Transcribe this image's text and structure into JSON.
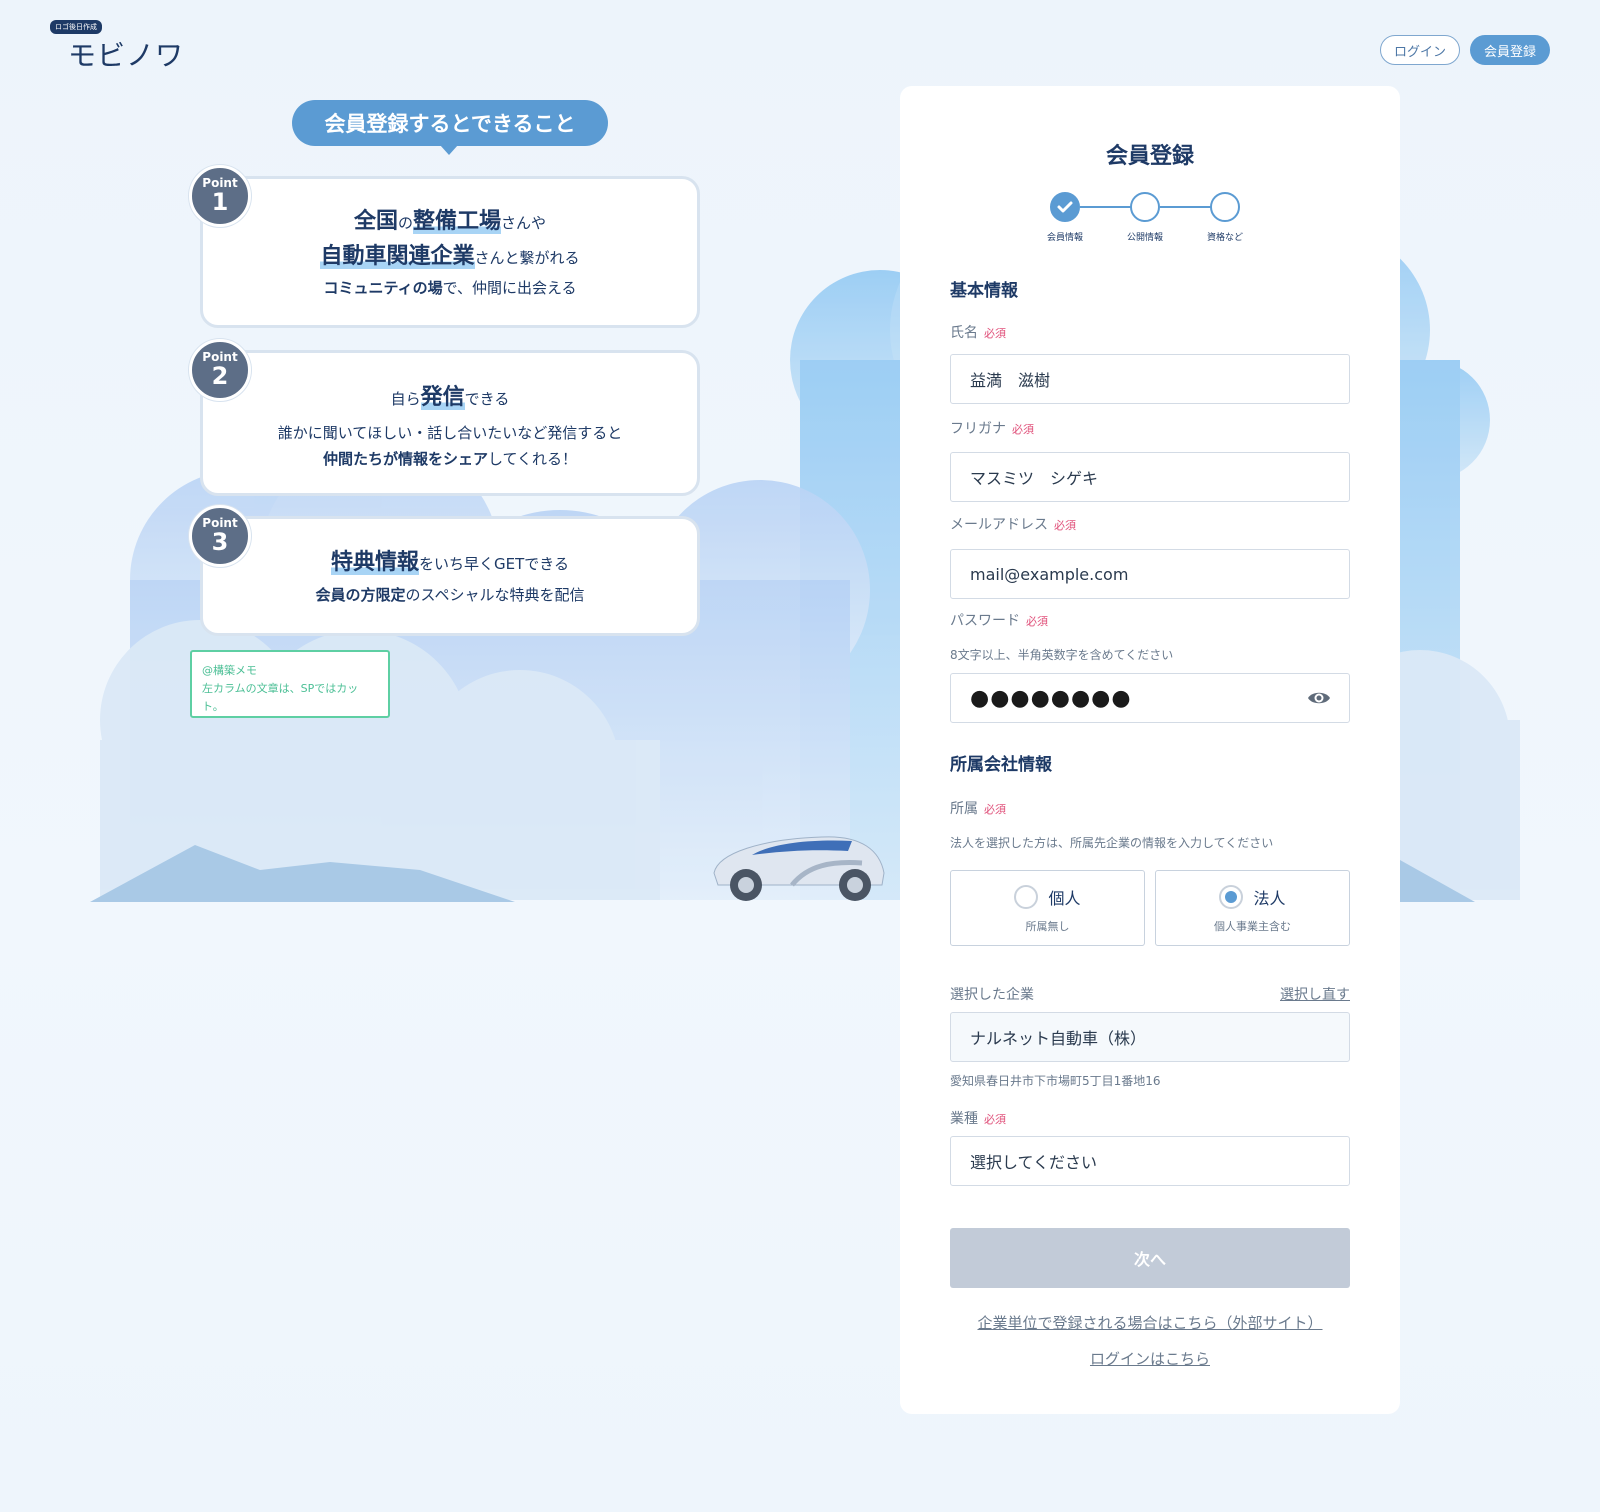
{
  "header": {
    "logo_badge": "ロゴ後日作成",
    "logo_text": "モビノワ",
    "login_label": "ログイン",
    "register_label": "会員登録"
  },
  "features": {
    "title": "会員登録するとできること",
    "point_label": "Point",
    "points": [
      {
        "number": "1",
        "line1_a": "全国",
        "line1_b": "の",
        "line1_c": "整備工場",
        "line1_d": "さんや",
        "line2_a": "自動車関連企業",
        "line2_b": "さんと繋がれる",
        "line3_a": "コミュニティの場",
        "line3_b": "で、仲間に出会える"
      },
      {
        "number": "2",
        "line1_a": "自ら",
        "line1_b": "発信",
        "line1_c": "できる",
        "line2": "誰かに聞いてほしい・話し合いたいなど発信すると",
        "line3_a": "仲間たちが情報をシェア",
        "line3_b": "してくれる！"
      },
      {
        "number": "3",
        "line1_a": "特典情報",
        "line1_b": "をいち早くGETできる",
        "line2_a": "会員の方限定",
        "line2_b": "のスペシャルな特典を配信"
      }
    ],
    "memo_line1": "@構築メモ",
    "memo_line2": "左カラムの文章は、SPではカット。"
  },
  "form": {
    "title": "会員登録",
    "steps": [
      "会員情報",
      "公開情報",
      "資格など"
    ],
    "section_basic": "基本情報",
    "required": "必須",
    "name_label": "氏名",
    "name_value": "益満　滋樹",
    "kana_label": "フリガナ",
    "kana_value": "マスミツ　シゲキ",
    "email_label": "メールアドレス",
    "email_value": "mail@example.com",
    "password_label": "パスワード",
    "password_hint": "8文字以上、半角英数字を含めてください",
    "password_dots": "●●●●●●●●",
    "section_company": "所属会社情報",
    "affiliation_label": "所属",
    "affiliation_hint": "法人を選択した方は、所属先企業の情報を入力してください",
    "option_individual": "個人",
    "option_individual_sub": "所属無し",
    "option_corporate": "法人",
    "option_corporate_sub": "個人事業主含む",
    "selected_company_label": "選択した企業",
    "reselect_label": "選択し直す",
    "company_value": "ナルネット自動車（株）",
    "company_address": "愛知県春日井市下市場町5丁目1番地16",
    "industry_label": "業種",
    "industry_placeholder": "選択してください",
    "next_label": "次へ",
    "corporate_link": "企業単位で登録される場合はこちら（外部サイト）",
    "login_link": "ログインはこちら"
  }
}
